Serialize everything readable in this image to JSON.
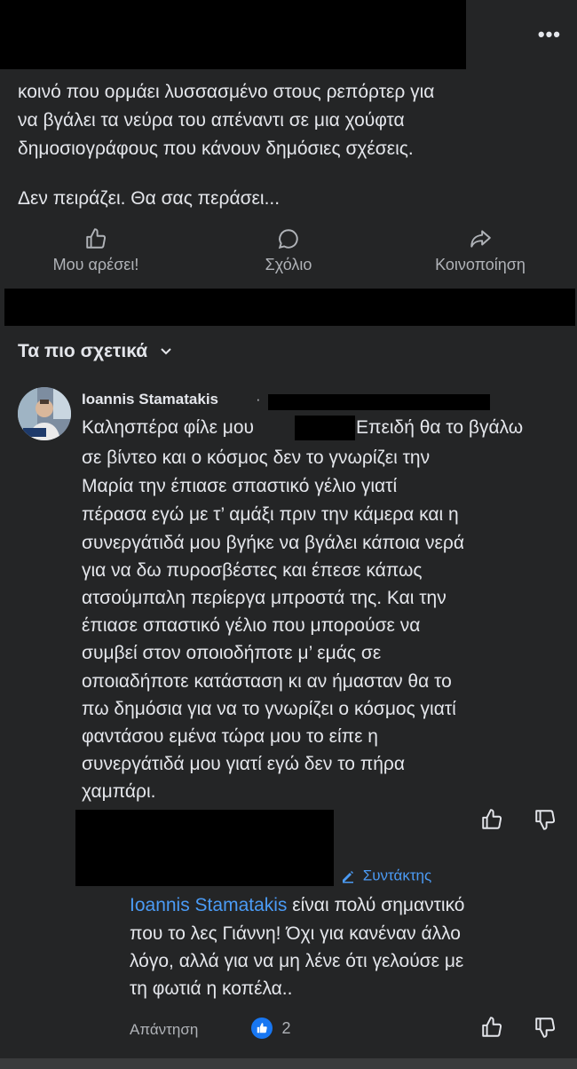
{
  "post": {
    "more_label": "•••",
    "text_lines": [
      "κοινό που ορμάει λυσσασμένο στους ρεπόρτερ για",
      "να βγάλει τα νεύρα του απέναντι σε μια χούφτα",
      "δημοσιογράφους που κάνουν δημόσιες σχέσεις.",
      "",
      "Δεν πειράζει. Θα σας περάσει..."
    ],
    "actions": {
      "like": "Μου αρέσει!",
      "comment": "Σχόλιο",
      "share": "Κοινοποίηση"
    }
  },
  "comments_header": {
    "sort_label": "Τα πιο σχετικά"
  },
  "comment": {
    "author": "Ioannis Stamatakis",
    "separator": "·",
    "lines": [
      "Καλησπέρα φίλε μου",
      "Επειδή θα το βγάλω",
      "σε βίντεο και ο κόσμος δεν το γνωρίζει την",
      "Μαρία την έπιασε σπαστικό γέλιο γιατί",
      "πέρασα εγώ με τ’ αμάξι πριν την κάμερα και η",
      "συνεργάτιδά μου βγήκε να βγάλει κάποια νερά",
      "για να δω πυροσβέστες και έπεσε κάπως",
      "ατσούμπαλη περίεργα μπροστά της. Και την",
      "έπιασε σπαστικό γέλιο που μπορούσε να",
      "συμβεί στον οποιοδήποτε μ’ εμάς σε",
      "οποιαδήποτε κατάσταση κι αν ήμασταν θα το",
      "πω δημόσια για να το γνωρίζει ο κόσμος γιατί",
      "φαντάσου εμένα τώρα μου το είπε η",
      "συνεργάτιδά μου γιατί εγώ δεν το πήρα",
      "χαμπάρι."
    ]
  },
  "reply": {
    "badge": "Συντάκτης",
    "mention": "Ioannis Stamatakis",
    "line1_rest": " είναι πολύ σημαντικό",
    "lines": [
      "που το λες Γιάννη! Όχι για κανέναν άλλο",
      "λόγο, αλλά για να μη λένε ότι γελούσε με",
      "τη φωτιά η κοπέλα.."
    ],
    "reply_label": "Απάντηση",
    "like_count": "2"
  },
  "colors": {
    "background": "#242526",
    "text": "#e4e6eb",
    "muted": "#b0b3b8",
    "accent": "#4b9bf5",
    "like_blue": "#1877f2"
  }
}
